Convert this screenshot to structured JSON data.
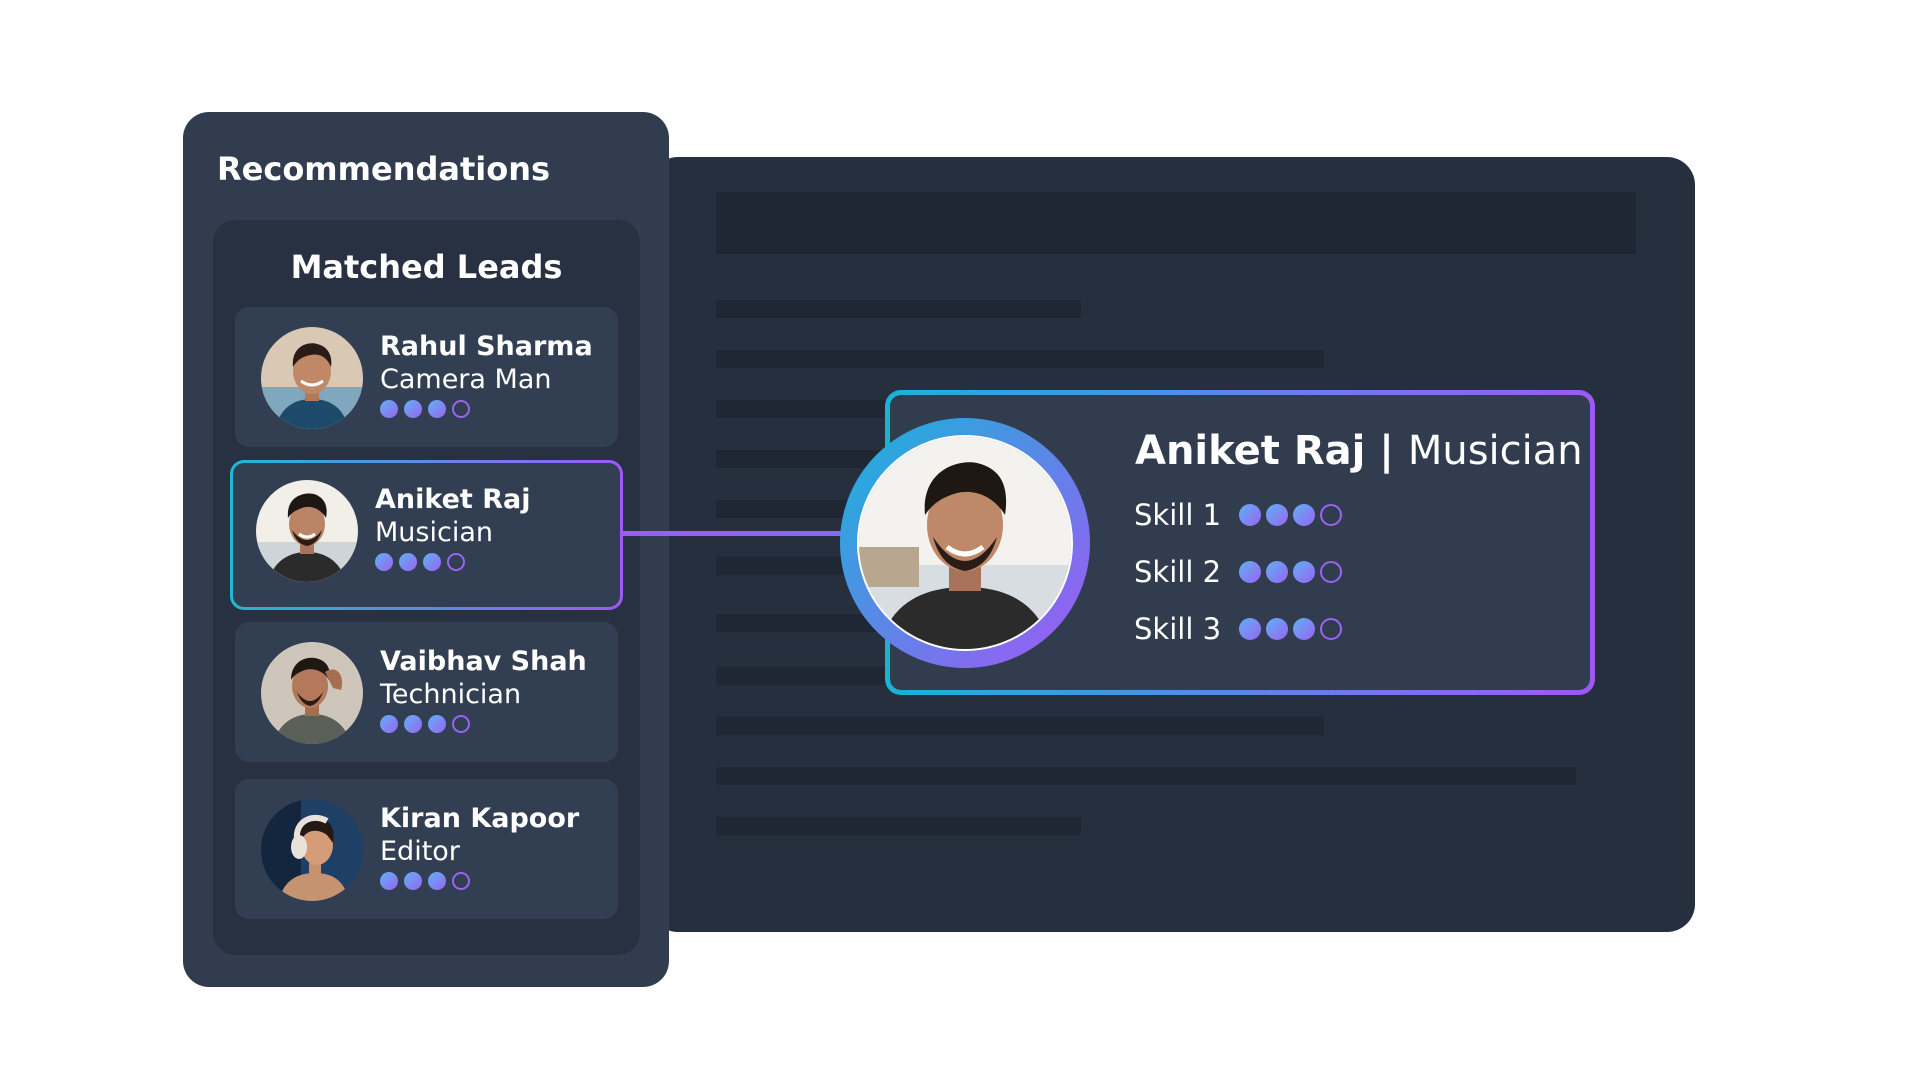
{
  "recommendations": {
    "title": "Recommendations",
    "matched_leads": {
      "title": "Matched Leads",
      "leads": [
        {
          "name": "Rahul Sharma",
          "role": "Camera Man",
          "rating": 3,
          "rating_max": 4,
          "selected": false
        },
        {
          "name": "Aniket Raj",
          "role": "Musician",
          "rating": 3,
          "rating_max": 4,
          "selected": true
        },
        {
          "name": "Vaibhav Shah",
          "role": "Technician",
          "rating": 3,
          "rating_max": 4,
          "selected": false
        },
        {
          "name": "Kiran Kapoor",
          "role": "Editor",
          "rating": 3,
          "rating_max": 4,
          "selected": false
        }
      ]
    }
  },
  "detail": {
    "name": "Aniket Raj",
    "separator": " | ",
    "role": "Musician",
    "skills": [
      {
        "label": "Skill 1",
        "rating": 3,
        "rating_max": 4
      },
      {
        "label": "Skill 2",
        "rating": 3,
        "rating_max": 4
      },
      {
        "label": "Skill 3",
        "rating": 3,
        "rating_max": 4
      }
    ]
  },
  "colors": {
    "accent_start": "#1fb8d6",
    "accent_end": "#9e5af5",
    "panel": "#313d4f",
    "window": "#262f3e"
  }
}
